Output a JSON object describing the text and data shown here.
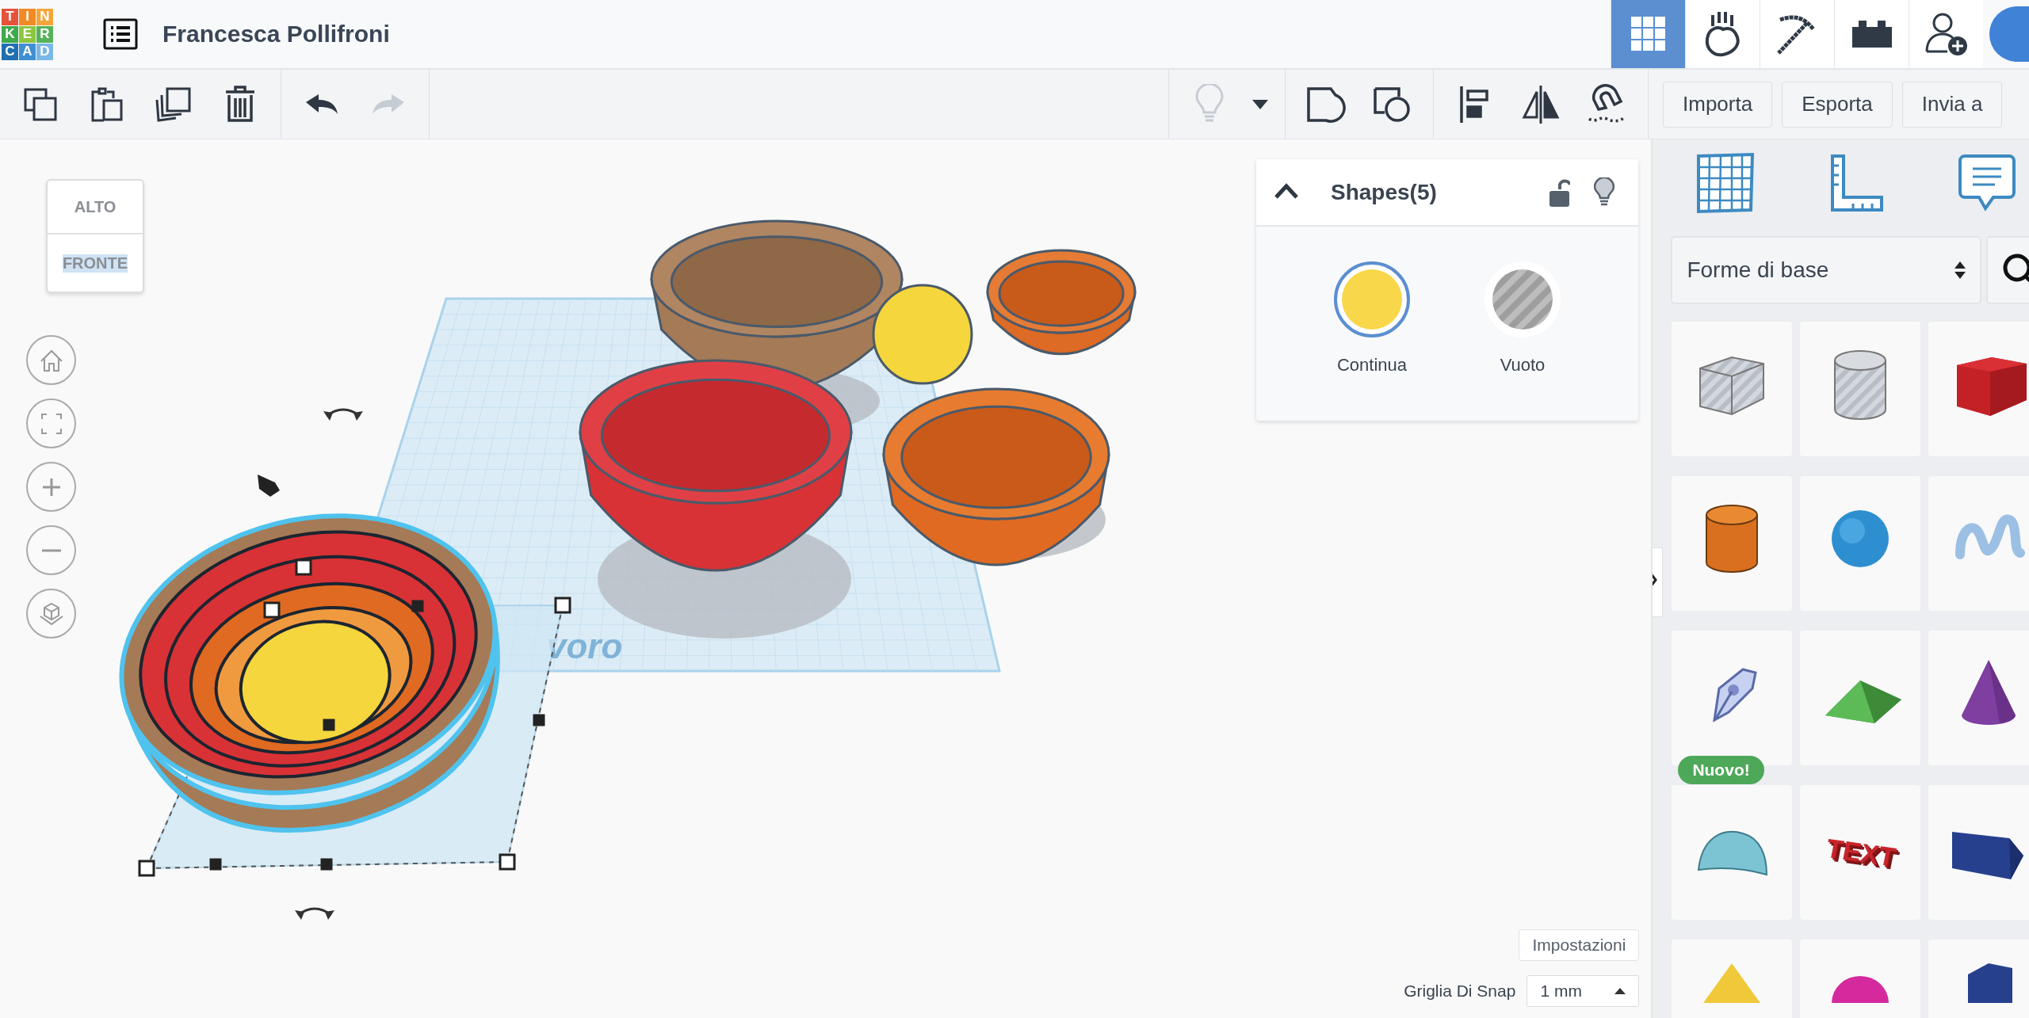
{
  "header": {
    "logo_letters": [
      "T",
      "I",
      "N",
      "K",
      "E",
      "R",
      "C",
      "A",
      "D"
    ],
    "title": "Francesca Pollifroni",
    "nav": [
      {
        "kind": "design",
        "selected": true
      },
      {
        "kind": "sim",
        "selected": false
      },
      {
        "kind": "build",
        "selected": false
      },
      {
        "kind": "bricks",
        "selected": false
      },
      {
        "kind": "invite",
        "selected": false
      }
    ]
  },
  "toolbar": {
    "groups": [
      [
        {
          "kind": "copy",
          "disabled": false
        },
        {
          "kind": "paste",
          "disabled": false
        },
        {
          "kind": "duplicate",
          "disabled": false
        },
        {
          "kind": "delete",
          "disabled": false
        }
      ],
      [
        {
          "kind": "undo",
          "disabled": false
        },
        {
          "kind": "redo",
          "disabled": true
        }
      ],
      [
        {
          "kind": "bulb",
          "disabled": true
        },
        {
          "kind": "dropdown",
          "disabled": false
        }
      ],
      [
        {
          "kind": "group",
          "disabled": false
        },
        {
          "kind": "ungroup",
          "disabled": false
        }
      ],
      [
        {
          "kind": "align",
          "disabled": false
        },
        {
          "kind": "mirror",
          "disabled": false
        },
        {
          "kind": "magnet",
          "disabled": false
        }
      ]
    ],
    "buttons": [
      "Importa",
      "Esporta",
      "Invia a"
    ]
  },
  "view_cube": {
    "top": "ALTO",
    "front": "FRONTE"
  },
  "workplane_label": "voro",
  "shapes_panel": {
    "title": "Shapes(5)",
    "expanded": true,
    "options": [
      {
        "kind": "solid",
        "label": "Continua",
        "selected": true
      },
      {
        "kind": "hole",
        "label": "Vuoto",
        "selected": false
      }
    ]
  },
  "settings_button": "Impostazioni",
  "snap": {
    "label": "Griglia Di Snap",
    "value": "1 mm"
  },
  "library": {
    "category": "Forme di base",
    "shapes": [
      {
        "kind": "box-hole"
      },
      {
        "kind": "cylinder-hole"
      },
      {
        "kind": "box"
      },
      {
        "kind": "cylinder"
      },
      {
        "kind": "sphere"
      },
      {
        "kind": "scribble"
      },
      {
        "kind": "generator",
        "badge": "Nuovo!"
      },
      {
        "kind": "roof"
      },
      {
        "kind": "cone"
      },
      {
        "kind": "round-roof"
      },
      {
        "kind": "text",
        "icon_text": "TEXT"
      },
      {
        "kind": "prism"
      },
      {
        "kind": "pyramid"
      },
      {
        "kind": "dome"
      },
      {
        "kind": "polygon"
      }
    ]
  }
}
